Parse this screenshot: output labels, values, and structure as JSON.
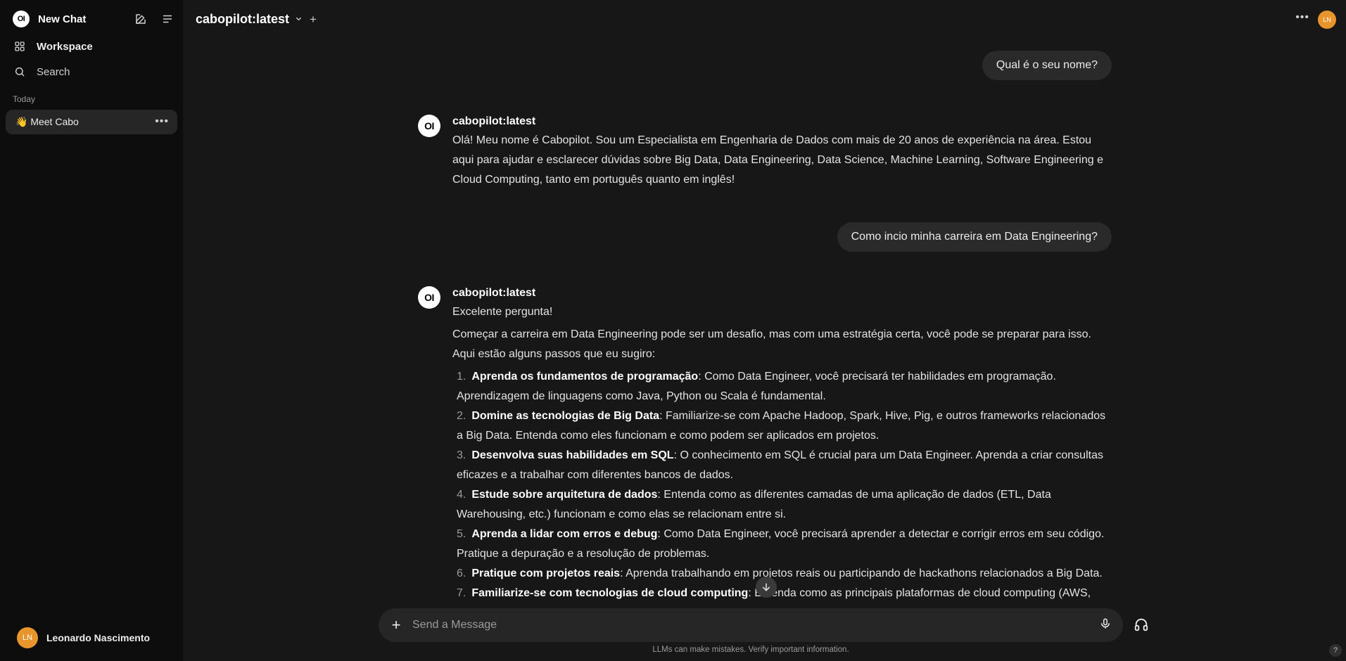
{
  "sidebar": {
    "logo_text": "OI",
    "new_chat_label": "New Chat",
    "workspace_label": "Workspace",
    "search_label": "Search",
    "section_today": "Today",
    "chats": [
      {
        "title": "👋 Meet Cabo"
      }
    ],
    "user": {
      "initials": "LN",
      "name": "Leonardo Nascimento"
    }
  },
  "header": {
    "model_name": "cabopilot:latest",
    "avatar_initials": "LN"
  },
  "conversation": {
    "messages": [
      {
        "role": "user",
        "text": "Qual é o seu nome?"
      },
      {
        "role": "assistant",
        "model": "cabopilot:latest",
        "paragraphs": [
          "Olá! Meu nome é Cabopilot. Sou um Especialista em Engenharia de Dados com mais de 20 anos de experiência na área. Estou aqui para ajudar e esclarecer dúvidas sobre Big Data, Data Engineering, Data Science, Machine Learning, Software Engineering e Cloud Computing, tanto em português quanto em inglês!"
        ]
      },
      {
        "role": "user",
        "text": "Como incio minha carreira em Data Engineering?"
      },
      {
        "role": "assistant",
        "model": "cabopilot:latest",
        "paragraphs": [
          "Excelente pergunta!",
          "Começar a carreira em Data Engineering pode ser um desafio, mas com uma estratégia certa, você pode se preparar para isso. Aqui estão alguns passos que eu sugiro:"
        ],
        "list": [
          {
            "num": "1.",
            "title": "Aprenda os fundamentos de programação",
            "text": ": Como Data Engineer, você precisará ter habilidades em programação. Aprendizagem de linguagens como Java, Python ou Scala é fundamental."
          },
          {
            "num": "2.",
            "title": "Domine as tecnologias de Big Data",
            "text": ": Familiarize-se com Apache Hadoop, Spark, Hive, Pig, e outros frameworks relacionados a Big Data. Entenda como eles funcionam e como podem ser aplicados em projetos."
          },
          {
            "num": "3.",
            "title": "Desenvolva suas habilidades em SQL",
            "text": ": O conhecimento em SQL é crucial para um Data Engineer. Aprenda a criar consultas eficazes e a trabalhar com diferentes bancos de dados."
          },
          {
            "num": "4.",
            "title": "Estude sobre arquitetura de dados",
            "text": ": Entenda como as diferentes camadas de uma aplicação de dados (ETL, Data Warehousing, etc.) funcionam e como elas se relacionam entre si."
          },
          {
            "num": "5.",
            "title": "Aprenda a lidar com erros e debug",
            "text": ": Como Data Engineer, você precisará aprender a detectar e corrigir erros em seu código. Pratique a depuração e a resolução de problemas."
          },
          {
            "num": "6.",
            "title": "Pratique com projetos reais",
            "text": ": Aprenda trabalhando em projetos reais ou participando de hackathons relacionados a Big Data."
          },
          {
            "num": "7.",
            "title": "Familiarize-se com tecnologias de cloud computing",
            "text": ": Entenda como as principais plataformas de cloud computing (AWS,"
          }
        ]
      }
    ]
  },
  "composer": {
    "placeholder": "Send a Message",
    "disclaimer": "LLMs can make mistakes. Verify important information."
  },
  "help_label": "?"
}
